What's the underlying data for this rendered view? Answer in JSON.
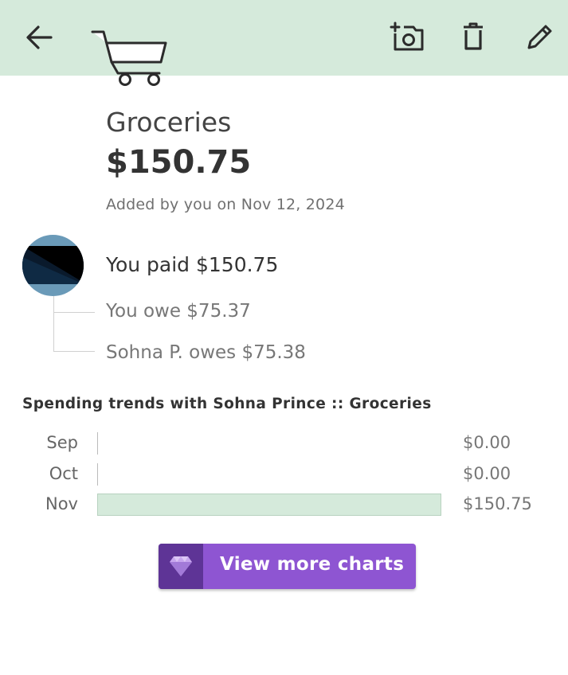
{
  "toolbar": {
    "back_icon": "arrow-left-icon",
    "add_photo_icon": "camera-plus-icon",
    "delete_icon": "trash-icon",
    "edit_icon": "pencil-icon",
    "background_color": "#d5eadb"
  },
  "expense": {
    "category_icon": "shopping-cart-icon",
    "title": "Groceries",
    "amount": "$150.75",
    "added_by": "Added by you on Nov 12, 2024"
  },
  "split": {
    "payer_avatar": "avatar",
    "paid_text": "You paid $150.75",
    "shares": [
      {
        "text": "You owe $75.37"
      },
      {
        "text": "Sohna P. owes $75.38"
      }
    ]
  },
  "trends": {
    "title": "Spending trends with Sohna Prince :: Groceries",
    "chart_data": {
      "type": "bar",
      "orientation": "horizontal",
      "categories": [
        "Sep",
        "Oct",
        "Nov"
      ],
      "values": [
        0,
        0,
        150.75
      ],
      "value_labels": [
        "$0.00",
        "$0.00",
        "$150.75"
      ],
      "bar_color": "#d5eadb"
    }
  },
  "cta": {
    "label": "View more charts",
    "icon": "gem-icon",
    "color": "#8e55d2",
    "icon_bg_color": "#5e3496"
  }
}
